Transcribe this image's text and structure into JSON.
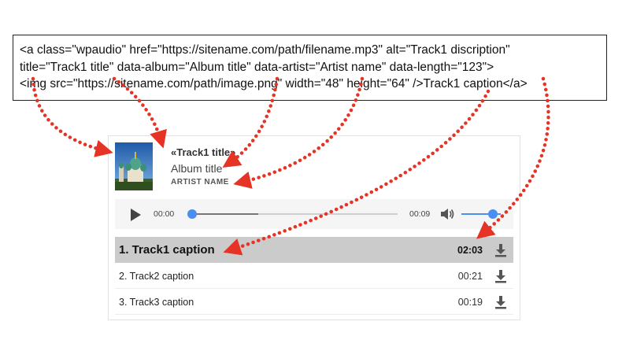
{
  "code": {
    "lines": [
      "<a class=\"wpaudio\" href=\"https://sitename.com/path/filename.mp3\" alt=\"Track1 discription\"",
      " title=\"Track1 title\" data-album=\"Album title\" data-artist=\"Artist name\" data-length=\"123\">",
      "<img src=\"https://sitename.com/path/image.png\" width=\"48\" height=\"64\" />Track1 caption</a>"
    ]
  },
  "player": {
    "title": "«Track1 title»",
    "album": "Album title",
    "artist": "ARTIST NAME",
    "time_current": "00:00",
    "time_total": "00:09",
    "progress_fraction": 0.0,
    "buffered_fraction": 0.32,
    "volume_fraction": 0.8,
    "icons": {
      "play": "play-icon",
      "volume": "volume-icon",
      "download": "download-icon"
    },
    "accent_color": "#4a8ff0"
  },
  "playlist": [
    {
      "label": "1. Track1 caption",
      "duration": "02:03",
      "active": true
    },
    {
      "label": "2. Track2 caption",
      "duration": "00:21",
      "active": false
    },
    {
      "label": "3. Track3 caption",
      "duration": "00:19",
      "active": false
    }
  ],
  "annotation_color": "#e53325"
}
